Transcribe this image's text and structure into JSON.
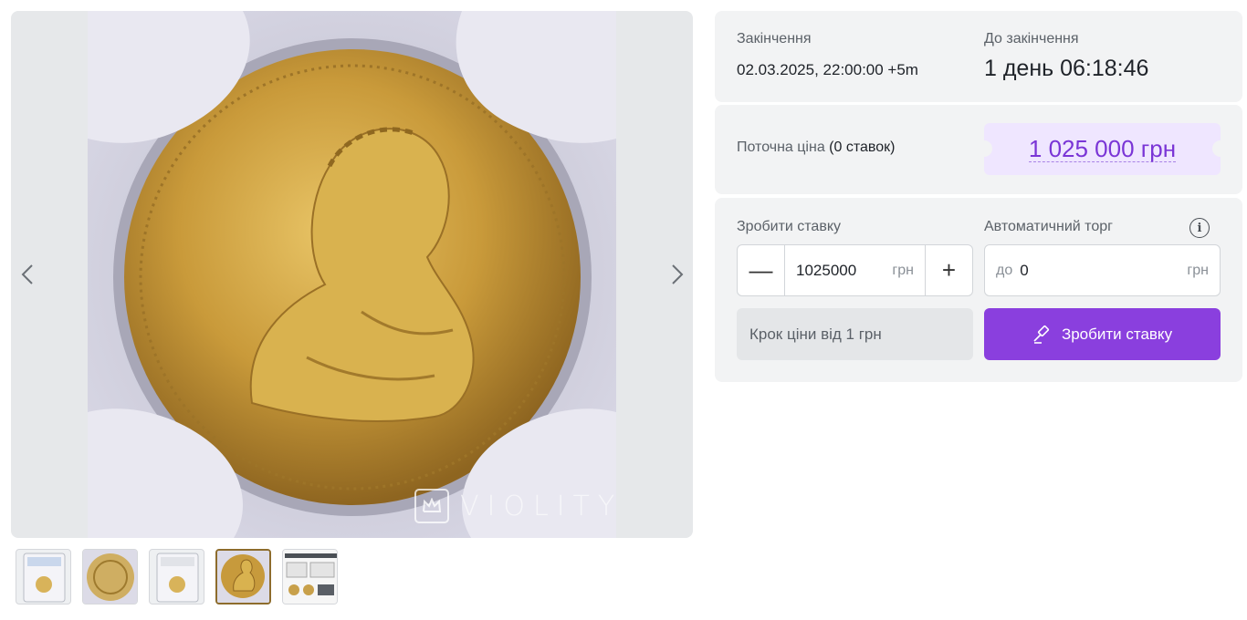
{
  "gallery": {
    "watermark_text": "VIOLITY",
    "prev_icon": "chevron-left-icon",
    "next_icon": "chevron-right-icon",
    "thumbnail_count": 5,
    "active_thumbnail_index": 4
  },
  "ending": {
    "label": "Закінчення",
    "value": "02.03.2025, 22:00:00 +5m"
  },
  "countdown": {
    "label": "До закінчення",
    "value": "1 день 06:18:46"
  },
  "price": {
    "label": "Поточна ціна",
    "bids": "(0 ставок)",
    "value": "1 025 000 грн"
  },
  "bid": {
    "label": "Зробити ставку",
    "minus": "—",
    "plus": "+",
    "amount": "1025000",
    "unit": "грн"
  },
  "auto": {
    "label": "Автоматичний торг",
    "prefix": "до",
    "value": "0",
    "unit": "грн",
    "info_icon": "info-icon"
  },
  "step_info": "Крок ціни від 1 грн",
  "bid_button": {
    "label": "Зробити ставку",
    "icon": "gavel-icon"
  },
  "colors": {
    "accent": "#8a3fde",
    "price": "#7a35d6",
    "price_bg": "#efe6ff",
    "panel_bg": "#f2f3f4"
  }
}
